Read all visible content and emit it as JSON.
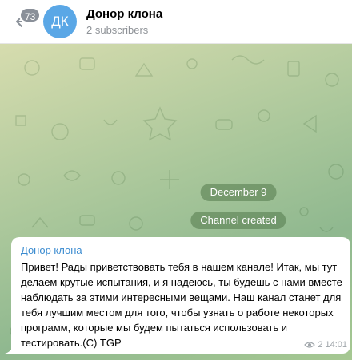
{
  "header": {
    "unread_count": "73",
    "avatar_initials": "ДК",
    "channel_name": "Донор клона",
    "subscribers": "2 subscribers"
  },
  "chat": {
    "date_label": "December 9",
    "service_message": "Channel created",
    "message": {
      "sender": "Донор клона",
      "text": "Привет! Рады приветствовать тебя в нашем канале! Итак, мы тут делаем крутые испытания, и я надеюсь, ты будешь с нами вместе наблюдать за этими интересными вещами. Наш канал станет для тебя лучшим местом для того, чтобы узнать о работе некоторых программ, которые мы будем пытаться использовать и тестировать.(С) TGP",
      "views": "2",
      "time": "14:01"
    }
  },
  "colors": {
    "accent": "#3a8bd0",
    "avatar": "#5aa7e6"
  },
  "icons": {
    "back": "back-arrow-icon",
    "views": "eye-icon"
  }
}
